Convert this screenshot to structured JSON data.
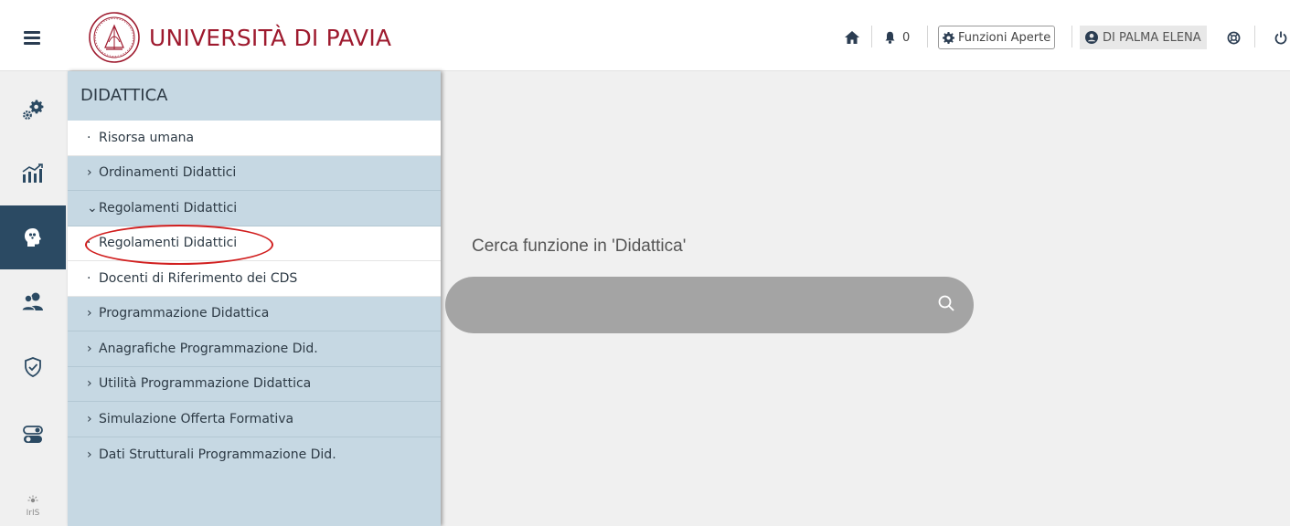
{
  "header": {
    "brand": "UNIVERSITÀ DI PAVIA",
    "notifications_count": "0",
    "funzioni_label": "Funzioni Aperte",
    "user_name": "DI PALMA ELENA"
  },
  "rail": {
    "items": [
      "gears-icon",
      "chart-icon",
      "head-icon",
      "users-icon",
      "shield-check-icon",
      "toggles-icon",
      "iris-icon"
    ],
    "active_index": 2
  },
  "panel": {
    "title": "DIDATTICA",
    "items": [
      {
        "marker": "·",
        "label": "Risorsa umana"
      },
      {
        "marker": "›",
        "label": "Ordinamenti Didattici"
      },
      {
        "marker": "⌄",
        "label": "Regolamenti Didattici"
      },
      {
        "marker": "·",
        "label": "Regolamenti Didattici"
      },
      {
        "marker": "·",
        "label": "Docenti di Riferimento dei CDS"
      },
      {
        "marker": "›",
        "label": "Programmazione Didattica"
      },
      {
        "marker": "›",
        "label": "Anagrafiche Programmazione Did."
      },
      {
        "marker": "›",
        "label": "Utilità Programmazione Didattica"
      },
      {
        "marker": "›",
        "label": "Simulazione Offerta Formativa"
      },
      {
        "marker": "›",
        "label": "Dati Strutturali Programmazione Did."
      }
    ]
  },
  "search": {
    "title": "Cerca funzione in 'Didattica'",
    "value": ""
  },
  "colors": {
    "brand": "#9e1a2e",
    "panel_bg": "#c6d8e3",
    "rail_active": "#2b4a63",
    "highlight_circle": "#d11f1f",
    "search_bg": "#a4a4a4"
  }
}
